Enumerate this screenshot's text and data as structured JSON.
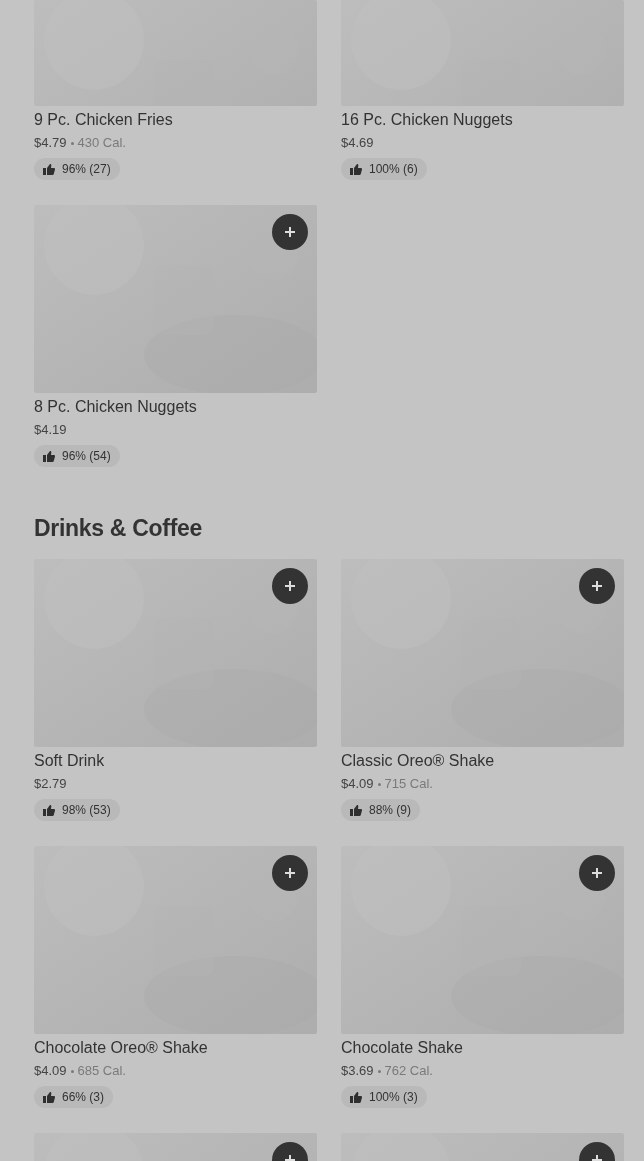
{
  "sections": [
    {
      "items": [
        {
          "kind": "top_cut",
          "name": "9 Pc. Chicken Fries",
          "price": "$4.79",
          "calories": "430 Cal.",
          "rating": "96% (27)"
        },
        {
          "kind": "top_cut",
          "name": "16 Pc. Chicken Nuggets",
          "price": "$4.69",
          "rating": "100% (6)"
        },
        {
          "kind": "full",
          "name": "8 Pc. Chicken Nuggets",
          "price": "$4.19",
          "rating": "96% (54)"
        }
      ]
    },
    {
      "title": "Drinks & Coffee",
      "items": [
        {
          "kind": "full",
          "name": "Soft Drink",
          "price": "$2.79",
          "rating": "98% (53)"
        },
        {
          "kind": "full",
          "name": "Classic Oreo® Shake",
          "price": "$4.09",
          "calories": "715 Cal.",
          "rating": "88% (9)"
        },
        {
          "kind": "full",
          "name": "Chocolate Oreo® Shake",
          "price": "$4.09",
          "calories": "685 Cal.",
          "rating": "66% (3)"
        },
        {
          "kind": "full",
          "name": "Chocolate Shake",
          "price": "$3.69",
          "calories": "762 Cal.",
          "rating": "100% (3)"
        },
        {
          "kind": "bottom_cut"
        },
        {
          "kind": "bottom_cut"
        }
      ]
    }
  ]
}
